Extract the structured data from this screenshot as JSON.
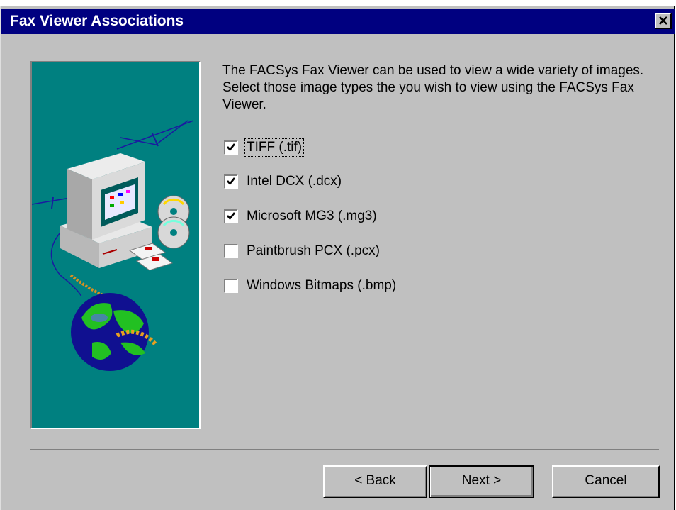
{
  "window": {
    "title": "Fax Viewer Associations",
    "close_glyph": "×"
  },
  "description": "The FACSys Fax Viewer can be used to view a wide variety of images.  Select those image types the you wish to view using the FACSys Fax Viewer.",
  "options": [
    {
      "label": "TIFF (.tif)",
      "checked": true
    },
    {
      "label": "Intel DCX (.dcx)",
      "checked": true
    },
    {
      "label": "Microsoft MG3 (.mg3)",
      "checked": true
    },
    {
      "label": "Paintbrush PCX (.pcx)",
      "checked": false
    },
    {
      "label": "Windows Bitmaps (.bmp)",
      "checked": false
    }
  ],
  "buttons": {
    "back": "< Back",
    "next": "Next >",
    "cancel": "Cancel"
  },
  "colors": {
    "titlebar": "#000080",
    "face": "#c0c0c0",
    "art_background": "#008080"
  },
  "icons": {
    "illustration": "computer-globe-illustration",
    "close": "close-icon",
    "check": "checkmark-icon"
  }
}
